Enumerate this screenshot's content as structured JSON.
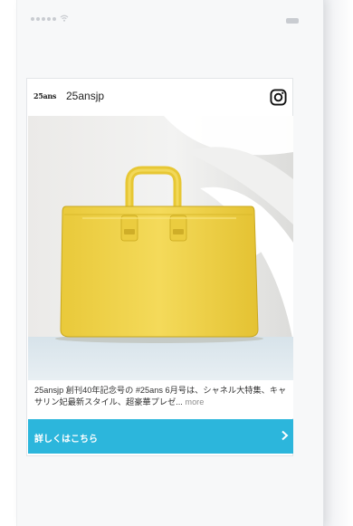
{
  "status_bar": {
    "signal_icon": "cellular-dots-icon",
    "wifi_icon": "wifi-icon",
    "battery_icon": "battery-icon"
  },
  "post": {
    "logo_text": "25ans",
    "username": "25ansjp",
    "platform_icon": "instagram-icon",
    "image_subject": "yellow-handbag-photo",
    "caption": "25ansjp 創刊40年記念号の #25ans 6月号は、シャネル大特集、キャサリン妃最新スタイル、超豪華プレゼ...",
    "more_label": "more",
    "cta_label": "詳しくはこちら",
    "cta_icon": "chevron-right-icon"
  },
  "colors": {
    "cta_background": "#2cb6dc",
    "bag_yellow": "#f1d44a",
    "page_background": "#f7f8f9"
  }
}
